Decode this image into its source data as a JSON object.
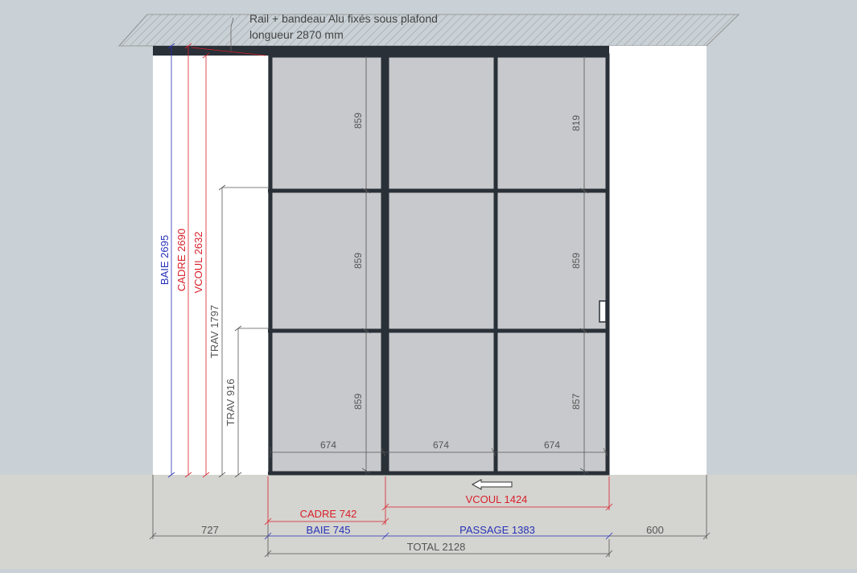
{
  "colors": {
    "background": "#c9d1d6",
    "floor": "#d4d4d0",
    "wall": "#ffffff",
    "glass": "#c7c9cc",
    "frame": "#2a3038",
    "dim_gray": "#555555",
    "dim_red": "#d8202a",
    "dim_blue": "#2631b8"
  },
  "annotation": {
    "line1": "Rail + bandeau Alu fixés sous plafond",
    "line2": "longueur 2870 mm"
  },
  "vertical_dimensions": {
    "baie": "BAIE 2695",
    "cadre": "CADRE 2690",
    "vcoul": "VCOUL 2632",
    "trav1797": "TRAV 1797",
    "trav916": "TRAV 916"
  },
  "pane_heights": {
    "fixed": [
      "859",
      "859",
      "859"
    ],
    "slide": [
      "819",
      "859",
      "857"
    ]
  },
  "pane_widths": [
    "674",
    "674",
    "674"
  ],
  "horizontal_dimensions": {
    "cadre": "CADRE 742",
    "vcoul": "VCOUL 1424",
    "left": "727",
    "baie": "BAIE 745",
    "passage": "PASSAGE 1383",
    "right": "600",
    "total": "TOTAL 2128"
  },
  "icons": {
    "slide_direction": "arrow-left-icon",
    "door_handle": "door-handle-icon"
  }
}
